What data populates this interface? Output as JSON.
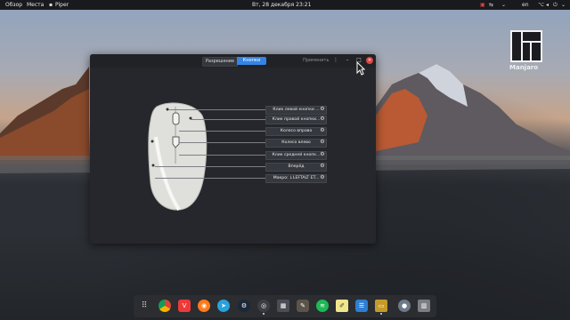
{
  "topbar": {
    "overview": "Обзор",
    "places": "Места",
    "app_name": "Piper",
    "datetime": "Вт, 28 декабря  23:21",
    "keyboard_layout": "en"
  },
  "desktop": {
    "logo_text": "Manjaro"
  },
  "window": {
    "tabs": [
      {
        "label": "Разрешение"
      },
      {
        "label": "Кнопки"
      }
    ],
    "active_tab": "Кнопки",
    "apply_label": "Применить",
    "button_mappings": [
      {
        "label": "Клик левой кнопки ..."
      },
      {
        "label": "Клик правой кнопки..."
      },
      {
        "label": "Колесо вправо"
      },
      {
        "label": "Колесо влево"
      },
      {
        "label": "Клик средней кнопк..."
      },
      {
        "label": "Вперёд"
      },
      {
        "label": "Макро: ↓LEFTALT ET..."
      }
    ]
  },
  "dock": {
    "icons": [
      "app-grid-icon",
      "chrome-icon",
      "vivaldi-icon",
      "firefox-icon",
      "telegram-icon",
      "steam-icon",
      "piper-icon",
      "terminal-icon",
      "gimp-icon",
      "spotify-icon",
      "notes-icon",
      "network-icon",
      "files-icon",
      "disks-icon",
      "trash-icon"
    ]
  },
  "colors": {
    "accent": "#3584e4",
    "close": "#e0453f"
  }
}
